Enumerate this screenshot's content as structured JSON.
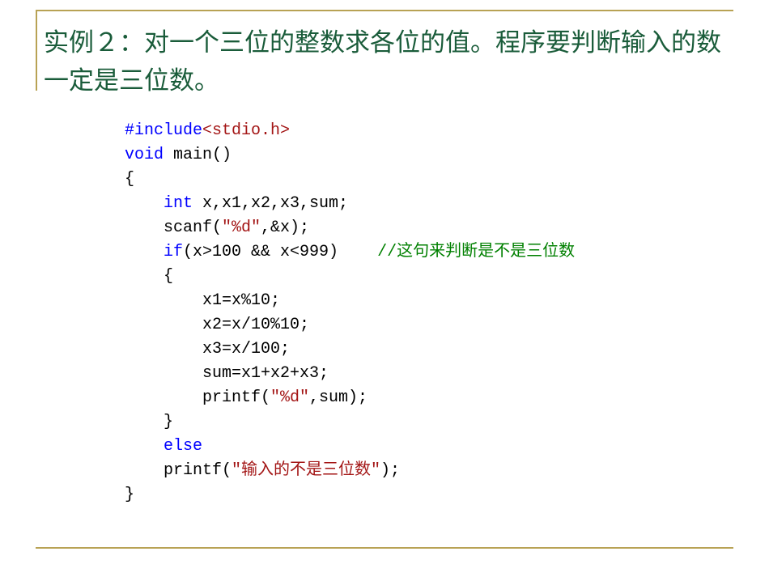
{
  "title": "实例２：对一个三位的整数求各位的值。程序要判断输入的数一定是三位数。",
  "code": {
    "l1_include": "#include",
    "l1_header": "<stdio.h>",
    "l2_void": "void",
    "l2_main": " main()",
    "l3": "{",
    "l4_int": "    int",
    "l4_vars": " x,x1,x2,x3,sum;",
    "l5_a": "    scanf(",
    "l5_fmt": "\"%d\"",
    "l5_b": ",&x);",
    "l6_if": "    if",
    "l6_cond": "(x>100 && x<999)    ",
    "l6_comment": "//这句来判断是不是三位数",
    "l7": "    {",
    "l8": "        x1=x%10;",
    "l9": "        x2=x/10%10;",
    "l10": "        x3=x/100;",
    "l11": "        sum=x1+x2+x3;",
    "l12_a": "        printf(",
    "l12_fmt": "\"%d\"",
    "l12_b": ",sum);",
    "l13": "    }",
    "l14_else": "    else",
    "l15_a": "    printf(",
    "l15_str": "\"输入的不是三位数\"",
    "l15_b": ");",
    "l16": "}"
  }
}
